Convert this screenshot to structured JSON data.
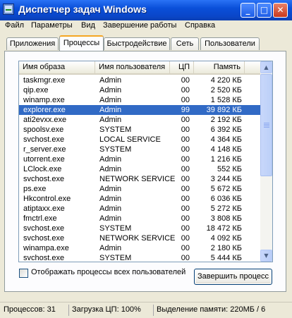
{
  "window": {
    "title": "Диспетчер задач Windows"
  },
  "menu": [
    "Файл",
    "Параметры",
    "Вид",
    "Завершение работы",
    "Справка"
  ],
  "tabs": [
    {
      "label": "Приложения",
      "active": false
    },
    {
      "label": "Процессы",
      "active": true
    },
    {
      "label": "Быстродействие",
      "active": false
    },
    {
      "label": "Сеть",
      "active": false
    },
    {
      "label": "Пользователи",
      "active": false
    }
  ],
  "process_table": {
    "columns": [
      "Имя образа",
      "Имя пользователя",
      "ЦП",
      "Память"
    ],
    "rows": [
      {
        "name": "taskmgr.exe",
        "user": "Admin",
        "cpu": "00",
        "mem": "4 220 КБ"
      },
      {
        "name": "qip.exe",
        "user": "Admin",
        "cpu": "00",
        "mem": "2 520 КБ"
      },
      {
        "name": "winamp.exe",
        "user": "Admin",
        "cpu": "00",
        "mem": "1 528 КБ"
      },
      {
        "name": "explorer.exe",
        "user": "Admin",
        "cpu": "99",
        "mem": "39 892 КБ",
        "selected": true
      },
      {
        "name": "ati2evxx.exe",
        "user": "Admin",
        "cpu": "00",
        "mem": "2 192 КБ"
      },
      {
        "name": "spoolsv.exe",
        "user": "SYSTEM",
        "cpu": "00",
        "mem": "6 392 КБ"
      },
      {
        "name": "svchost.exe",
        "user": "LOCAL SERVICE",
        "cpu": "00",
        "mem": "4 364 КБ"
      },
      {
        "name": "r_server.exe",
        "user": "SYSTEM",
        "cpu": "00",
        "mem": "4 148 КБ"
      },
      {
        "name": "utorrent.exe",
        "user": "Admin",
        "cpu": "00",
        "mem": "1 216 КБ"
      },
      {
        "name": "LClock.exe",
        "user": "Admin",
        "cpu": "00",
        "mem": "552 КБ"
      },
      {
        "name": "svchost.exe",
        "user": "NETWORK SERVICE",
        "cpu": "00",
        "mem": "3 244 КБ"
      },
      {
        "name": "ps.exe",
        "user": "Admin",
        "cpu": "00",
        "mem": "5 672 КБ"
      },
      {
        "name": "Hkcontrol.exe",
        "user": "Admin",
        "cpu": "00",
        "mem": "6 036 КБ"
      },
      {
        "name": "atiptaxx.exe",
        "user": "Admin",
        "cpu": "00",
        "mem": "5 272 КБ"
      },
      {
        "name": "fmctrl.exe",
        "user": "Admin",
        "cpu": "00",
        "mem": "3 808 КБ"
      },
      {
        "name": "svchost.exe",
        "user": "SYSTEM",
        "cpu": "00",
        "mem": "18 472 КБ"
      },
      {
        "name": "svchost.exe",
        "user": "NETWORK SERVICE",
        "cpu": "00",
        "mem": "4 092 КБ"
      },
      {
        "name": "winampa.exe",
        "user": "Admin",
        "cpu": "00",
        "mem": "2 180 КБ"
      },
      {
        "name": "svchost.exe",
        "user": "SYSTEM",
        "cpu": "00",
        "mem": "5 444 КБ"
      }
    ]
  },
  "options": {
    "show_all_users_label": "Отображать процессы всех пользователей",
    "show_all_users_checked": false
  },
  "end_process_button": "Завершить процесс",
  "status": {
    "processes": "Процессов: 31",
    "cpu_load": "Загрузка ЦП: 100%",
    "commit": "Выделение памяти: 220МБ / 6"
  },
  "titlebar_buttons": {
    "minimize_icon": "minimize-icon",
    "maximize_icon": "maximize-icon",
    "close_icon": "close-icon"
  },
  "colors": {
    "selection": "#316ac5",
    "titlebar": "#0a4fd9",
    "active_tab_accent": "#f5a623"
  }
}
